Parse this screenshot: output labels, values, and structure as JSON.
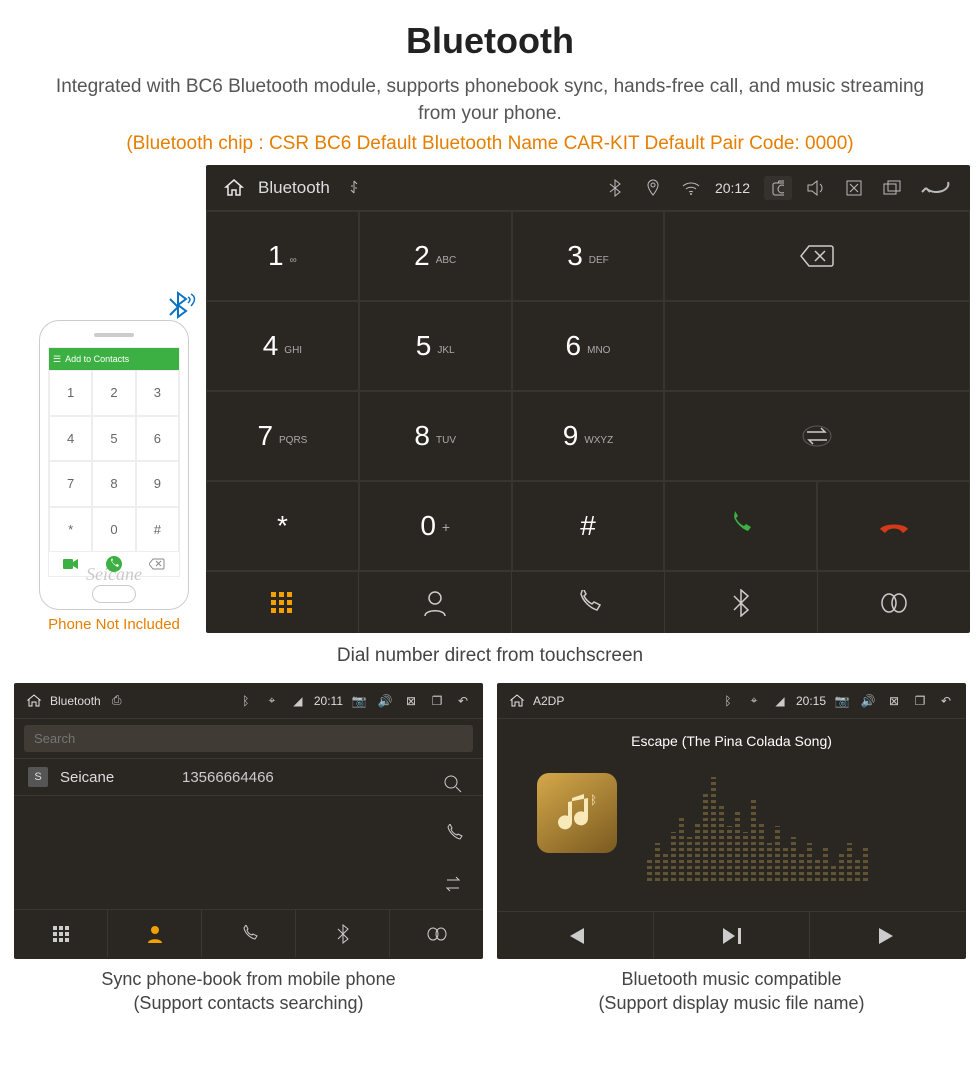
{
  "header": {
    "title": "Bluetooth",
    "description": "Integrated with BC6 Bluetooth module, supports phonebook sync, hands-free call, and music streaming from your phone.",
    "spec": "(Bluetooth chip : CSR BC6     Default Bluetooth Name CAR-KIT     Default Pair Code: 0000)"
  },
  "phone": {
    "topbar": "Add to Contacts",
    "keys": [
      "1",
      "2",
      "3",
      "4",
      "5",
      "6",
      "7",
      "8",
      "9",
      "*",
      "0",
      "#"
    ],
    "watermark": "Seicane",
    "note": "Phone Not Included"
  },
  "headunit": {
    "title": "Bluetooth",
    "time": "20:12",
    "keys": [
      {
        "num": "1",
        "let": "∞"
      },
      {
        "num": "2",
        "let": "ABC"
      },
      {
        "num": "3",
        "let": "DEF"
      },
      {
        "num": "4",
        "let": "GHI"
      },
      {
        "num": "5",
        "let": "JKL"
      },
      {
        "num": "6",
        "let": "MNO"
      },
      {
        "num": "7",
        "let": "PQRS"
      },
      {
        "num": "8",
        "let": "TUV"
      },
      {
        "num": "9",
        "let": "WXYZ"
      },
      {
        "num": "*",
        "let": ""
      },
      {
        "num": "0",
        "let": "+"
      },
      {
        "num": "#",
        "let": ""
      }
    ],
    "caption": "Dial number direct from touchscreen"
  },
  "phonebook": {
    "title": "Bluetooth",
    "time": "20:11",
    "search_placeholder": "Search",
    "contact_badge": "S",
    "contact_name": "Seicane",
    "contact_phone": "13566664466",
    "caption_line1": "Sync phone-book from mobile phone",
    "caption_line2": "(Support contacts searching)"
  },
  "music": {
    "title": "A2DP",
    "time": "20:15",
    "song": "Escape (The Pina Colada Song)",
    "caption_line1": "Bluetooth music compatible",
    "caption_line2": "(Support display music file name)"
  }
}
